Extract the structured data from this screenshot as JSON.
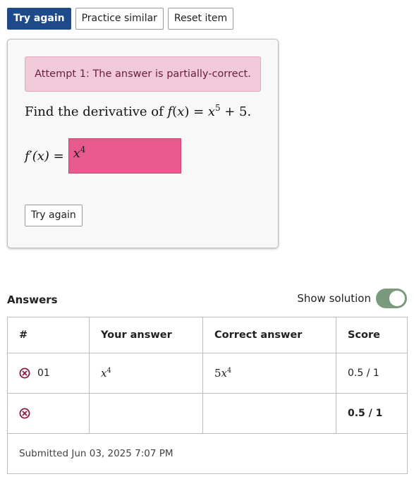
{
  "toolbar": {
    "try_again_label": "Try again",
    "practice_similar_label": "Practice similar",
    "reset_item_label": "Reset item"
  },
  "item": {
    "alert_text": "Attempt 1: The answer is partially-correct.",
    "question_prefix": "Find the derivative of ",
    "answer_prefix": "f′(x) = ",
    "answer_value_base": "x",
    "answer_value_exp": "4",
    "retry_label": "Try again"
  },
  "answers": {
    "section_label": "Answers",
    "show_solution_label": "Show solution",
    "show_solution_on": true,
    "columns": [
      "#",
      "Your answer",
      "Correct answer",
      "Score"
    ],
    "rows": [
      {
        "id": "01",
        "your_base": "x",
        "your_exp": "4",
        "correct_coef": "5",
        "correct_base": "x",
        "correct_exp": "4",
        "score": "0.5 / 1"
      }
    ],
    "total_score": "0.5 / 1",
    "submitted_text": "Submitted Jun 03, 2025 7:07 PM"
  },
  "colors": {
    "primary": "#1f4a8a",
    "alert_bg": "#f0cad8",
    "answer_box_incorrect": "#e85a8e",
    "toggle_on": "#7a9a7d",
    "error_icon": "#8b1a44"
  }
}
